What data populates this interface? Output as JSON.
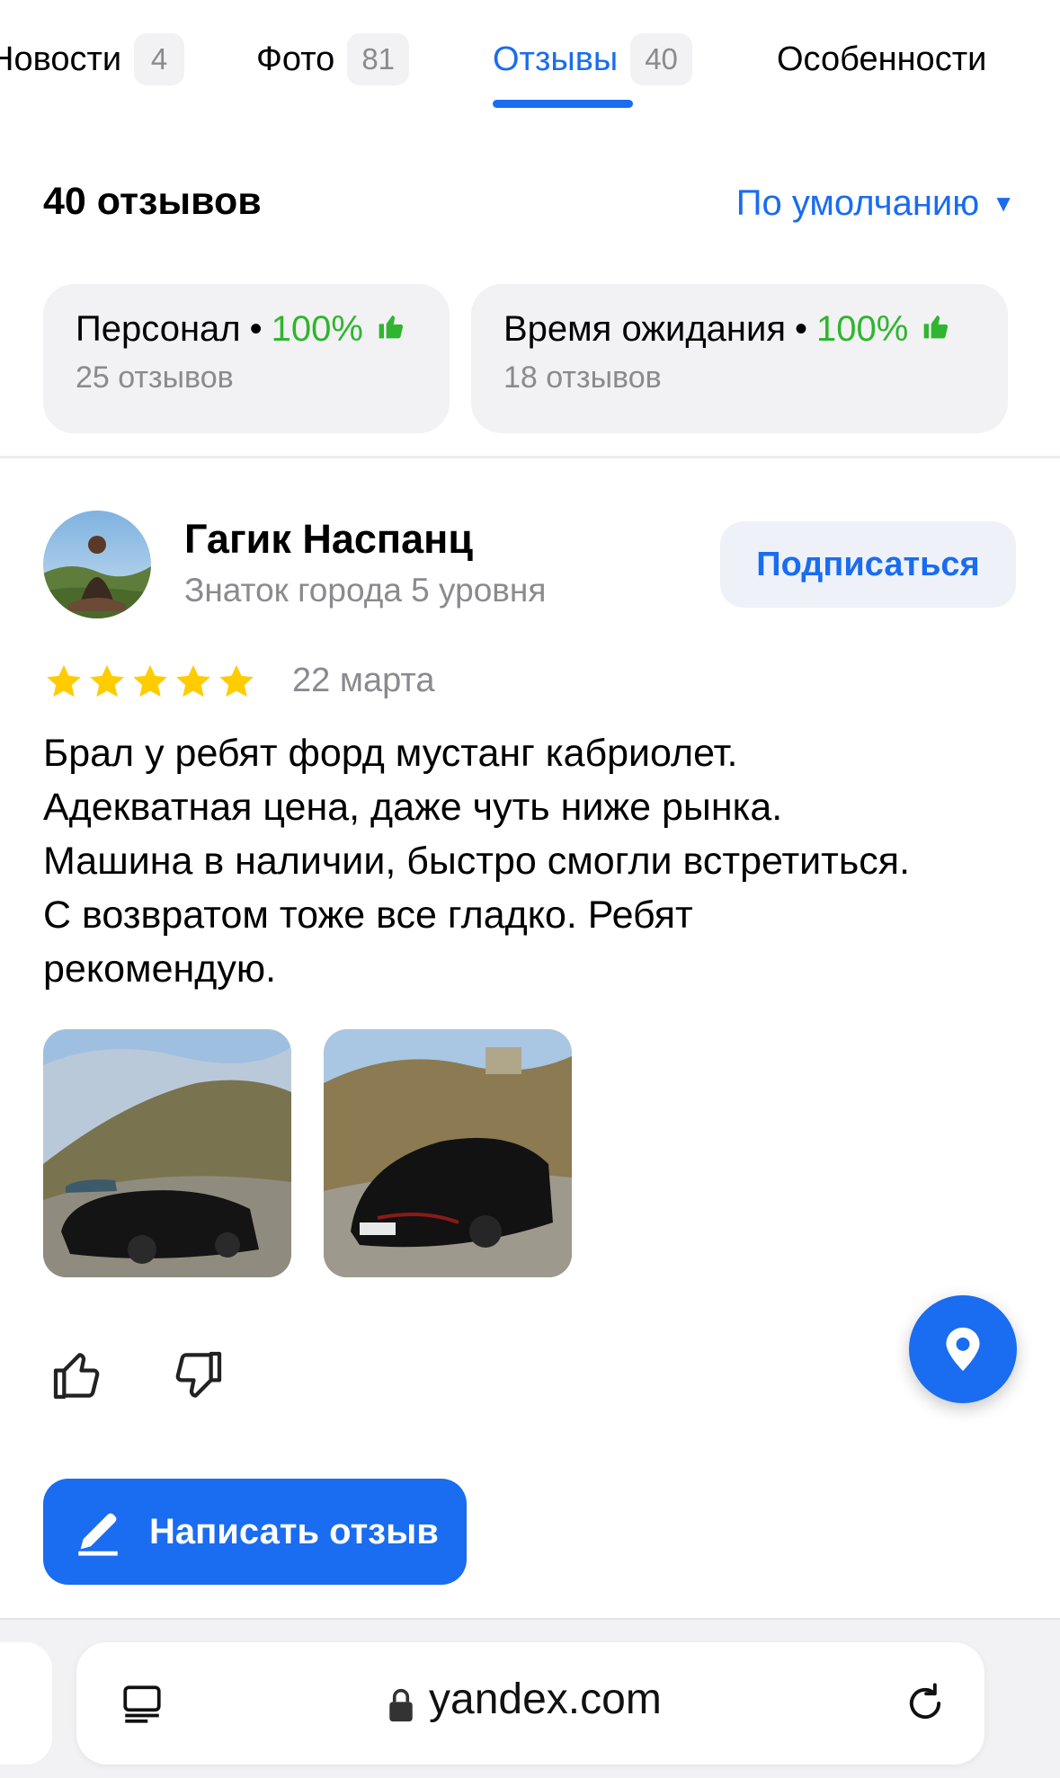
{
  "tabs": [
    {
      "label": "Новости",
      "count": "4"
    },
    {
      "label": "Фото",
      "count": "81"
    },
    {
      "label": "Отзывы",
      "count": "40",
      "active": true
    },
    {
      "label": "Особенности"
    }
  ],
  "reviews_header": {
    "count_label": "40 отзывов",
    "sort_label": "По умолчанию",
    "sort_arrow": "▼"
  },
  "aspects": [
    {
      "name": "Персонал",
      "dot": "•",
      "percent": "100%",
      "sub": "25 отзывов"
    },
    {
      "name": "Время ожидания",
      "dot": "•",
      "percent": "100%",
      "sub": "18 отзывов"
    }
  ],
  "review": {
    "author_name": "Гагик Наспанц",
    "author_level": "Знаток города 5 уровня",
    "subscribe_label": "Подписаться",
    "rating": 5,
    "date": "22 марта",
    "text": "Брал у ребят форд мустанг кабриолет.\nАдекватная цена, даже чуть ниже рынка.\nМашина в наличии, быстро смогли встретиться.\nС возвратом тоже все гладко. Ребят\nрекомендую."
  },
  "actions": {
    "write_review_label": "Написать отзыв"
  },
  "browser": {
    "url": "yandex.com"
  },
  "icons": [
    "thumb-up-icon",
    "star-icon",
    "like-icon",
    "dislike-icon",
    "location-pin-icon",
    "pencil-icon",
    "tabs-icon",
    "lock-icon",
    "reload-icon"
  ],
  "colors": {
    "accent": "#1a6cf0",
    "positive": "#2fb52f",
    "star": "#ffcc00",
    "muted": "#8a8a8f"
  }
}
